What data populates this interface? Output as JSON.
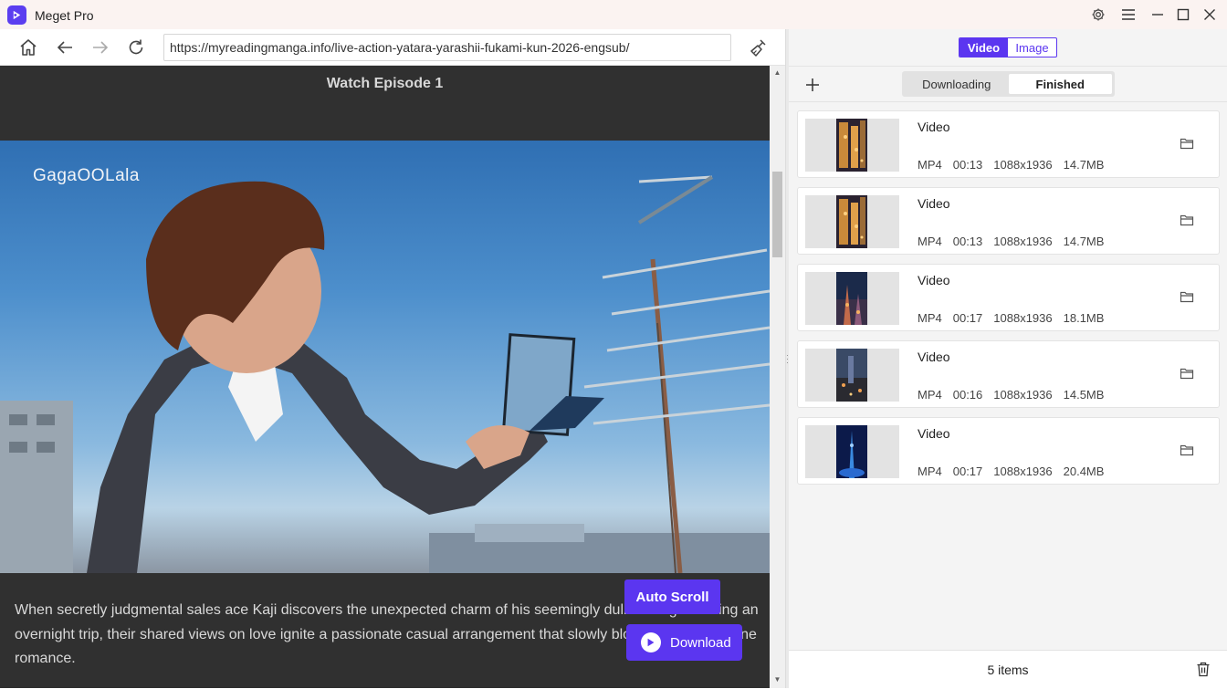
{
  "app": {
    "title": "Meget Pro"
  },
  "titlebar": {
    "icons": [
      "settings-icon",
      "menu-icon",
      "minimize-icon",
      "maximize-icon",
      "close-icon"
    ]
  },
  "browser": {
    "url": "https://myreadingmanga.info/live-action-yatara-yarashii-fukami-kun-2026-engsub/",
    "icons": [
      "home-icon",
      "back-icon",
      "forward-icon",
      "reload-icon",
      "clean-icon"
    ]
  },
  "page": {
    "heading": "Watch Episode 1",
    "watermark": "GagaOOLala",
    "description": "When secretly judgmental sales ace Kaji discovers the unexpected charm of his seemingly dull colleague during an overnight trip, their shared views on love ignite a passionate casual arrangement that slowly blossoms into genuine romance.",
    "auto_scroll_label": "Auto Scroll",
    "download_label": "Download"
  },
  "panel": {
    "type_toggle": {
      "video": "Video",
      "image": "Image",
      "selected": "Video"
    },
    "tabs": [
      {
        "label": "Downloading",
        "active": false
      },
      {
        "label": "Finished",
        "active": true
      }
    ],
    "items": [
      {
        "title": "Video",
        "format": "MP4",
        "duration": "00:13",
        "resolution": "1088x1936",
        "size": "14.7MB",
        "thumb": "city-night-orange"
      },
      {
        "title": "Video",
        "format": "MP4",
        "duration": "00:13",
        "resolution": "1088x1936",
        "size": "14.7MB",
        "thumb": "city-night-orange"
      },
      {
        "title": "Video",
        "format": "MP4",
        "duration": "00:17",
        "resolution": "1088x1936",
        "size": "18.1MB",
        "thumb": "city-night-blue"
      },
      {
        "title": "Video",
        "format": "MP4",
        "duration": "00:16",
        "resolution": "1088x1936",
        "size": "14.5MB",
        "thumb": "city-night-dusk"
      },
      {
        "title": "Video",
        "format": "MP4",
        "duration": "00:17",
        "resolution": "1088x1936",
        "size": "20.4MB",
        "thumb": "tower-blue"
      }
    ],
    "footer": {
      "count": "5 items"
    }
  },
  "colors": {
    "accent": "#5b36f0",
    "webview_bg": "#303030",
    "panel_bg": "#f4f4f4"
  }
}
